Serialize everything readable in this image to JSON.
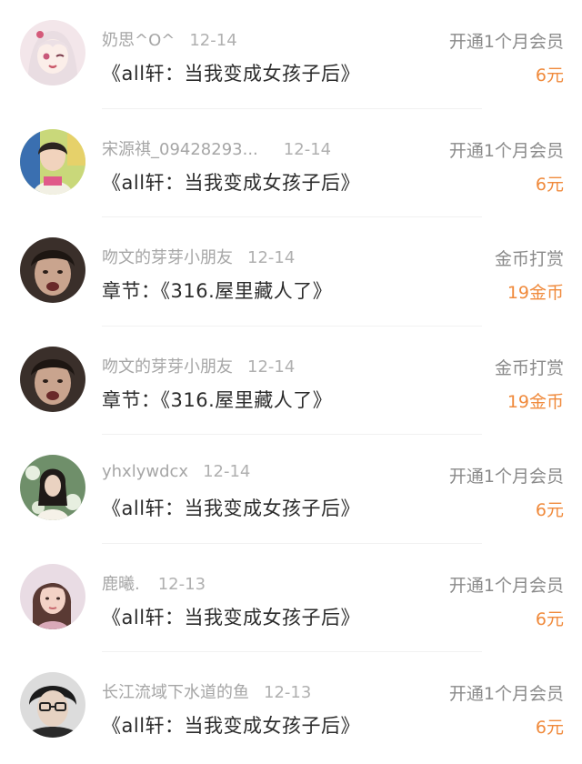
{
  "colors": {
    "amount": "#f08a3c",
    "meta": "#a6a6a6",
    "title": "#2b2b2b"
  },
  "items": [
    {
      "user": "奶思^O^",
      "date": "12-14",
      "title": "《all轩：当我变成女孩子后》",
      "type": "开通1个月会员",
      "amount": "6元",
      "avatar": "anime-girl-avatar"
    },
    {
      "user": "宋源祺_09428293...",
      "date": "12-14",
      "title": "《all轩：当我变成女孩子后》",
      "type": "开通1个月会员",
      "amount": "6元",
      "avatar": "person-photo-avatar"
    },
    {
      "user": "吻文的芽芽小朋友",
      "date": "12-14",
      "title": "章节：《316.屋里藏人了》",
      "type": "金币打赏",
      "amount": "19金币",
      "avatar": "person-photo-avatar"
    },
    {
      "user": "吻文的芽芽小朋友",
      "date": "12-14",
      "title": "章节：《316.屋里藏人了》",
      "type": "金币打赏",
      "amount": "19金币",
      "avatar": "person-photo-avatar"
    },
    {
      "user": "yhxlywdcx",
      "date": "12-14",
      "title": "《all轩：当我变成女孩子后》",
      "type": "开通1个月会员",
      "amount": "6元",
      "avatar": "person-photo-avatar"
    },
    {
      "user": "鹿曦.",
      "date": "12-13",
      "title": "《all轩：当我变成女孩子后》",
      "type": "开通1个月会员",
      "amount": "6元",
      "avatar": "person-photo-avatar"
    },
    {
      "user": "长江流域下水道的鱼",
      "date": "12-13",
      "title": "《all轩：当我变成女孩子后》",
      "type": "开通1个月会员",
      "amount": "6元",
      "avatar": "person-photo-avatar"
    }
  ]
}
